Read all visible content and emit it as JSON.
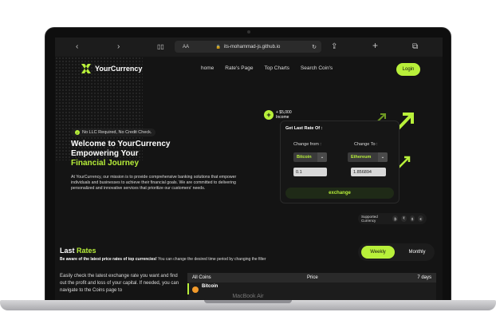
{
  "device_label": "MacBook Air",
  "browser": {
    "aa_label": "AA",
    "url": "its-mohammad-js.github.io",
    "icons": [
      "chevron-left-icon",
      "chevron-right-icon",
      "book-icon",
      "lock-icon",
      "reload-icon",
      "share-icon",
      "plus-icon",
      "tabs-icon"
    ]
  },
  "nav": {
    "brand": "YourCurrency",
    "links": [
      "home",
      "Rate's Page",
      "Top Charts",
      "Search Coin's"
    ],
    "login_label": "Login"
  },
  "hero": {
    "badge": "No LLC Required, No Credit Check.",
    "title_line1": "Welcome to YourCurrency",
    "title_line2": "Empowering Your",
    "title_accent": "Financial Journey",
    "description": "At YourCurrency, our mission is to provide comprehensive banking solutions that empower individuals and businesses to achieve their financial goals. We are committed to delivering personalized and innovative services that prioritize our customers' needs."
  },
  "income_tag": {
    "amount": "+ $5,000",
    "label": "Income"
  },
  "rate_card": {
    "title": "Get Last Rate Of :",
    "from_label": "Change from :",
    "to_label": "Change To :",
    "from_coin": "Bitcoin",
    "to_coin": "Ethereum",
    "from_value": "0.1",
    "to_value": "1.856894",
    "button_label": "exchange"
  },
  "supported": {
    "label": "Supported Currency",
    "symbols": [
      "₿",
      "₹",
      "$",
      "€"
    ]
  },
  "rates": {
    "title_prefix": "Last",
    "title_accent": "Rates",
    "subtitle_bold": "Be aware of the latest price rates of top currencies!",
    "subtitle_rest": "You can change the desired time period by changing the filter",
    "toggle": {
      "weekly": "Weekly",
      "monthly": "Monthly"
    },
    "intro": "Easily check the latest exchange rate you want and find out the profit and loss of your capital. If needed, you can navigate to the Coins page to"
  },
  "table": {
    "headers": [
      "All Coins",
      "Price",
      "7 days"
    ],
    "rows": [
      {
        "name": "Bitcoin"
      }
    ]
  },
  "colors": {
    "accent": "#b8f03a",
    "background": "#141414"
  }
}
